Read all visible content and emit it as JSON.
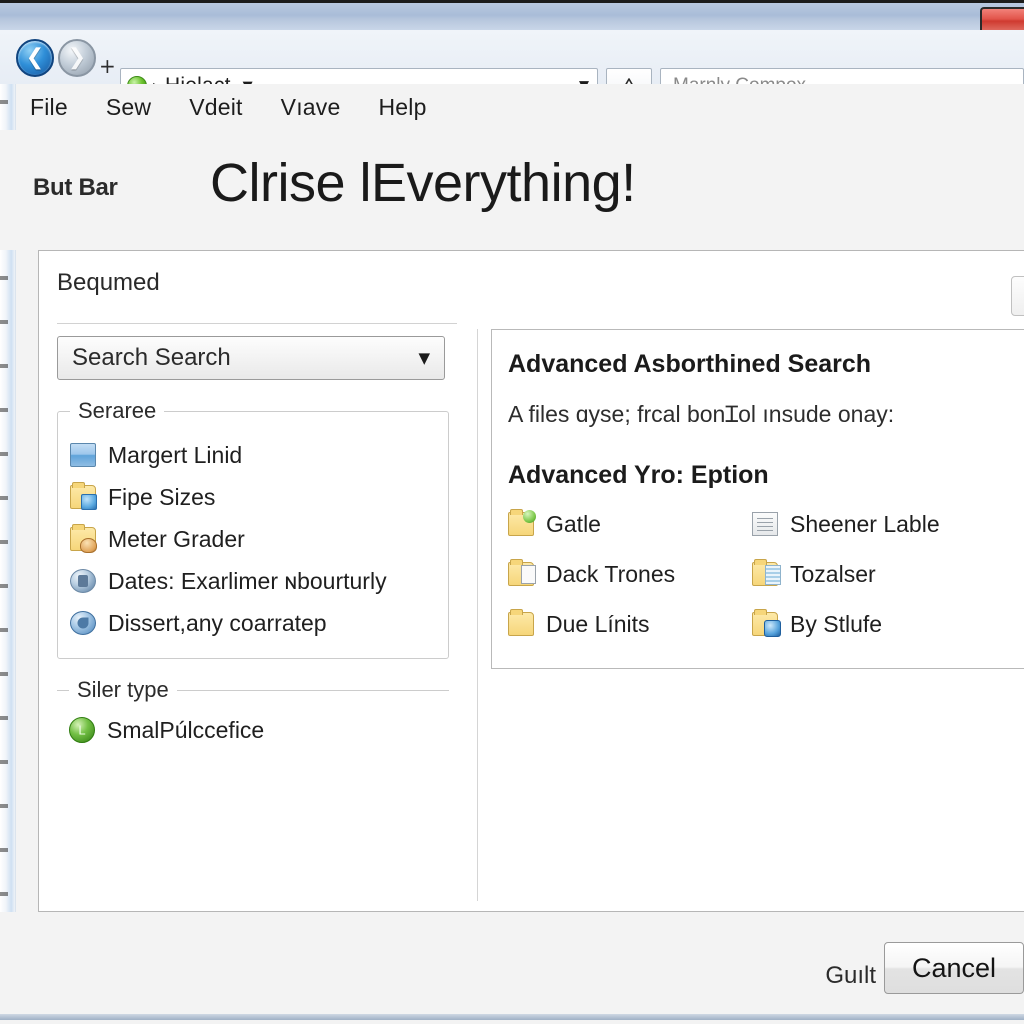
{
  "window": {
    "close_icon": "close-icon"
  },
  "nav": {
    "back_icon": "back-arrow-icon",
    "forward_icon": "forward-arrow-icon",
    "plus_label": "+",
    "breadcrumb_icon": "green-globe-icon",
    "breadcrumb_separator": "▸",
    "breadcrumb_text": "Hielact",
    "breadcrumb_caret": "▼",
    "history_dropdown_caret": "▼",
    "refresh_icon": "△",
    "search_placeholder": "Marnly Compox"
  },
  "menu": {
    "items": [
      {
        "label": "File"
      },
      {
        "label": "Sew"
      },
      {
        "label": "Vdeit"
      },
      {
        "label": "Vıave"
      },
      {
        "label": "Help"
      }
    ]
  },
  "header": {
    "bar_label": "But Bar",
    "title": "Clrise lEverything!"
  },
  "panel": {
    "heading": "Bequmed",
    "next_icon": "❯"
  },
  "left_pane": {
    "combo": {
      "value": "Search  Search",
      "caret": "▼"
    },
    "group_label": "Seraree",
    "items": [
      {
        "label": "Margert Linid",
        "icon": "window-icon"
      },
      {
        "label": "Fipe Sizes",
        "icon": "folder-blue-badge-icon"
      },
      {
        "label": "Meter Grader",
        "icon": "folder-tan-badge-icon"
      },
      {
        "label": "Dates: Exarlimer ɴbourturly",
        "icon": "orb-gray-icon"
      },
      {
        "label": "Dissert,any coarratep",
        "icon": "orb-blue-icon"
      }
    ],
    "type_group_label": "Siler type",
    "type_items": [
      {
        "label": "SmalPúlccefice",
        "icon": "green-circle-icon"
      }
    ]
  },
  "right_pane": {
    "title": "Advanced  Asborthined  Search",
    "subtitle": "A files ɑyse; frcal bonꞮol ınsude onay:",
    "section_title": "Advanced Yro: Eption",
    "items": [
      {
        "label": "Gatle",
        "icon": "folder-green-badge-icon"
      },
      {
        "label": "Sheener Lable",
        "icon": "document-icon"
      },
      {
        "label": "Dack Trones",
        "icon": "folder-doc-icon"
      },
      {
        "label": "Tozalser",
        "icon": "folder-lines-icon"
      },
      {
        "label": "Due Línits",
        "icon": "folder-icon"
      },
      {
        "label": "By Stlufe",
        "icon": "folder-pen-icon"
      }
    ]
  },
  "footer": {
    "note": "Guılt",
    "cancel_label": "Cancel"
  },
  "colors": {
    "titlebar": "#a9bcd8",
    "close": "#cf3a30",
    "panel_bg": "#ffffff",
    "app_bg": "#f3f3f3",
    "accent_green": "#2f7d10"
  }
}
